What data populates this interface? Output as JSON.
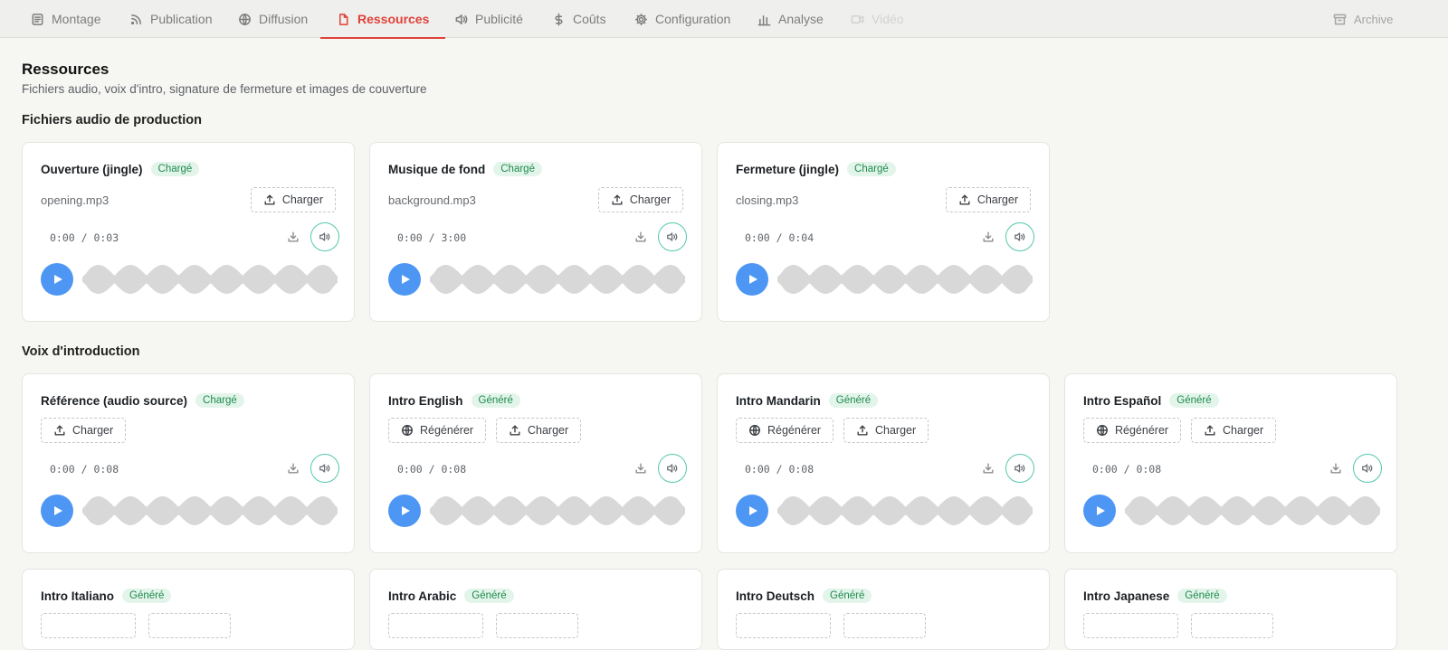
{
  "tabs": [
    {
      "label": "Montage",
      "icon": "document-icon"
    },
    {
      "label": "Publication",
      "icon": "rss-icon"
    },
    {
      "label": "Diffusion",
      "icon": "globe-icon"
    },
    {
      "label": "Ressources",
      "icon": "file-icon",
      "active": true
    },
    {
      "label": "Publicité",
      "icon": "speaker-icon"
    },
    {
      "label": "Coûts",
      "icon": "dollar-icon"
    },
    {
      "label": "Configuration",
      "icon": "gear-icon"
    },
    {
      "label": "Analyse",
      "icon": "bar-chart-icon"
    },
    {
      "label": "Vidéo",
      "icon": "video-icon",
      "disabled": true
    },
    {
      "label": "Archive",
      "icon": "archive-icon"
    }
  ],
  "colors": {
    "accent_active": "#e0413a",
    "badge_bg": "#e3f5ea",
    "badge_text": "#1f8a4e",
    "play": "#4d96f4",
    "volume_ring": "#55c7ae",
    "waveform": "#d8d8d8"
  },
  "page": {
    "title": "Ressources",
    "subtitle": "Fichiers audio, voix d'intro, signature de fermeture et images de couverture"
  },
  "sections": {
    "production": {
      "title": "Fichiers audio de production",
      "cards": [
        {
          "title": "Ouverture (jingle)",
          "badge": "Chargé",
          "filename": "opening.mp3",
          "upload_label": "Charger",
          "time": "0:00 / 0:03"
        },
        {
          "title": "Musique de fond",
          "badge": "Chargé",
          "filename": "background.mp3",
          "upload_label": "Charger",
          "time": "0:00 / 3:00"
        },
        {
          "title": "Fermeture (jingle)",
          "badge": "Chargé",
          "filename": "closing.mp3",
          "upload_label": "Charger",
          "time": "0:00 / 0:04"
        }
      ]
    },
    "intro": {
      "title": "Voix d'introduction",
      "cards": [
        {
          "title": "Référence (audio source)",
          "badge": "Chargé",
          "upload_label": "Charger",
          "time": "0:00 / 0:08"
        },
        {
          "title": "Intro English",
          "badge": "Généré",
          "regen_label": "Régénérer",
          "upload_label": "Charger",
          "time": "0:00 / 0:08"
        },
        {
          "title": "Intro Mandarin",
          "badge": "Généré",
          "regen_label": "Régénérer",
          "upload_label": "Charger",
          "time": "0:00 / 0:08"
        },
        {
          "title": "Intro Español",
          "badge": "Généré",
          "regen_label": "Régénérer",
          "upload_label": "Charger",
          "time": "0:00 / 0:08"
        },
        {
          "title": "Intro Italiano",
          "badge": "Généré"
        },
        {
          "title": "Intro Arabic",
          "badge": "Généré"
        },
        {
          "title": "Intro Deutsch",
          "badge": "Généré"
        },
        {
          "title": "Intro Japanese",
          "badge": "Généré"
        }
      ]
    }
  }
}
